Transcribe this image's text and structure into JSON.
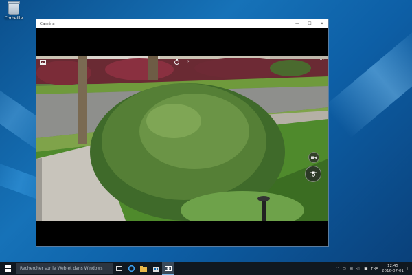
{
  "desktop": {
    "recycle_bin_label": "Corbeille"
  },
  "window": {
    "title": "Caméra",
    "minimize": "—",
    "maximize": "☐",
    "close": "✕"
  },
  "camera": {
    "gallery_icon": "photo-gallery-icon",
    "more": "···"
  },
  "taskbar": {
    "search_placeholder": "Rechercher sur le Web et dans Windows",
    "language": "FRA",
    "time": "12:45",
    "date": "2016-07-01"
  }
}
